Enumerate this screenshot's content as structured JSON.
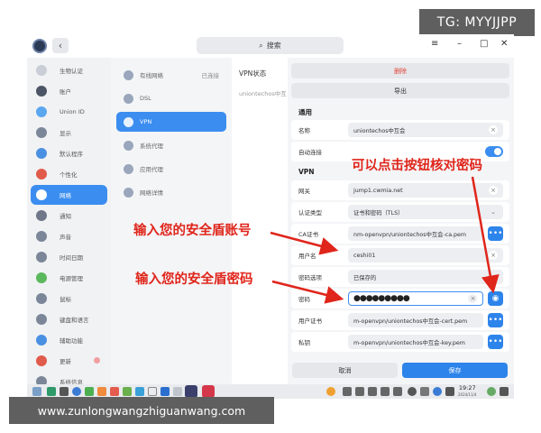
{
  "watermarks": {
    "top": "TG: MYYJJPP",
    "bottom": "www.zunlongwangzhiguanwang.com"
  },
  "titlebar": {
    "back": "‹",
    "search_placeholder": "搜索",
    "minimize": "–",
    "maximize": "□",
    "close": "✕"
  },
  "sidebar": {
    "items": [
      {
        "label": "生物认证",
        "icon": "fingerprint-icon",
        "color": "#c9cdd6"
      },
      {
        "label": "账户",
        "icon": "user-icon",
        "color": "#4c5566"
      },
      {
        "label": "Union ID",
        "icon": "cloud-icon",
        "color": "#5aa7f0"
      },
      {
        "label": "显示",
        "icon": "display-icon",
        "color": "#7b8799"
      },
      {
        "label": "默认程序",
        "icon": "apps-icon",
        "color": "#4a90e2"
      },
      {
        "label": "个性化",
        "icon": "palette-icon",
        "color": "#e05b4b"
      },
      {
        "label": "网络",
        "icon": "network-icon",
        "color": "#ffffff"
      },
      {
        "label": "通知",
        "icon": "bell-icon",
        "color": "#6f7788"
      },
      {
        "label": "声音",
        "icon": "sound-icon",
        "color": "#7b8799"
      },
      {
        "label": "时间日期",
        "icon": "clock-icon",
        "color": "#7b8799"
      },
      {
        "label": "电源管理",
        "icon": "power-icon",
        "color": "#5cb85c"
      },
      {
        "label": "鼠标",
        "icon": "mouse-icon",
        "color": "#7b8799"
      },
      {
        "label": "键盘和语言",
        "icon": "keyboard-icon",
        "color": "#7b8799"
      },
      {
        "label": "辅助功能",
        "icon": "accessibility-icon",
        "color": "#4a90e2"
      },
      {
        "label": "更新",
        "icon": "update-icon",
        "color": "#e05b4b"
      },
      {
        "label": "系统信息",
        "icon": "info-icon",
        "color": "#7b8799"
      }
    ]
  },
  "middle": {
    "items": [
      {
        "label": "有线网络",
        "status": "已连接"
      },
      {
        "label": "DSL",
        "status": ""
      },
      {
        "label": "VPN",
        "status": ""
      },
      {
        "label": "系统代理",
        "status": ""
      },
      {
        "label": "应用代理",
        "status": ""
      },
      {
        "label": "网络详情",
        "status": ""
      }
    ]
  },
  "vpn_list": {
    "header": "VPN状态",
    "item": "uniontechos中互"
  },
  "detail": {
    "delete_label": "删除",
    "export_label": "导出",
    "section_general": "通用",
    "name_label": "名称",
    "name_value": "uniontechos中互会",
    "autoconnect_label": "自动连接",
    "section_vpn": "VPN",
    "gateway_label": "网关",
    "gateway_value": "jump1.cwmia.net",
    "auth_type_label": "认证类型",
    "auth_type_value": "证书和密码（TLS）",
    "ca_label": "CA证书",
    "ca_value": "nm-openvpn/uniontechos中互会-ca.pem",
    "username_label": "用户名",
    "username_value": "ceshi01",
    "pw_options_label": "密码选项",
    "pw_options_value": "已保存的",
    "password_label": "密码",
    "password_value": "●●●●●●●●●",
    "user_cert_label": "用户证书",
    "user_cert_value": "m-openvpn/uniontechos中互会-cert.pem",
    "private_key_label": "私钥",
    "private_key_value": "m-openvpn/uniontechos中互会-key.pem",
    "cancel_label": "取消",
    "save_label": "保存"
  },
  "taskbar": {
    "time": "19:27",
    "date": "2024/11/4"
  },
  "annotations": {
    "view_password": "可以点击按钮核对密码",
    "enter_account": "输入您的安全盾账号",
    "enter_password": "输入您的安全盾密码"
  },
  "colors": {
    "accent": "#3b8ef0",
    "annotation": "#e0251b",
    "delete_text": "#e0463c"
  }
}
